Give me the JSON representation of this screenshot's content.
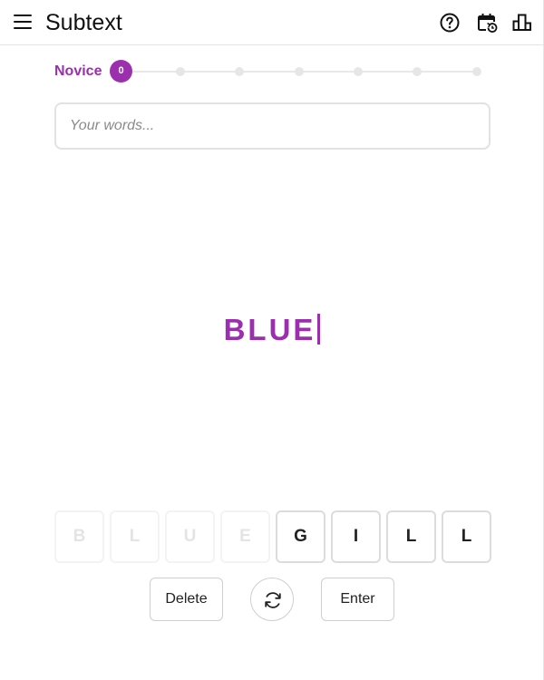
{
  "header": {
    "title": "Subtext",
    "icons": [
      "menu-icon",
      "help-icon",
      "calendar-history-icon",
      "leaderboard-icon"
    ]
  },
  "progress": {
    "rank": "Novice",
    "score": "0",
    "milestones": 7
  },
  "input": {
    "placeholder": "Your words...",
    "value": ""
  },
  "current_word": "BLUE",
  "tiles": [
    {
      "letter": "B",
      "used": true
    },
    {
      "letter": "L",
      "used": true
    },
    {
      "letter": "U",
      "used": true
    },
    {
      "letter": "E",
      "used": true
    },
    {
      "letter": "G",
      "used": false
    },
    {
      "letter": "I",
      "used": false
    },
    {
      "letter": "L",
      "used": false
    },
    {
      "letter": "L",
      "used": false
    }
  ],
  "controls": {
    "delete_label": "Delete",
    "shuffle_icon": "shuffle-icon",
    "enter_label": "Enter"
  },
  "colors": {
    "accent": "#9b2fae",
    "border": "#dcdcdc",
    "used_tile_text": "#e4e4e4"
  }
}
